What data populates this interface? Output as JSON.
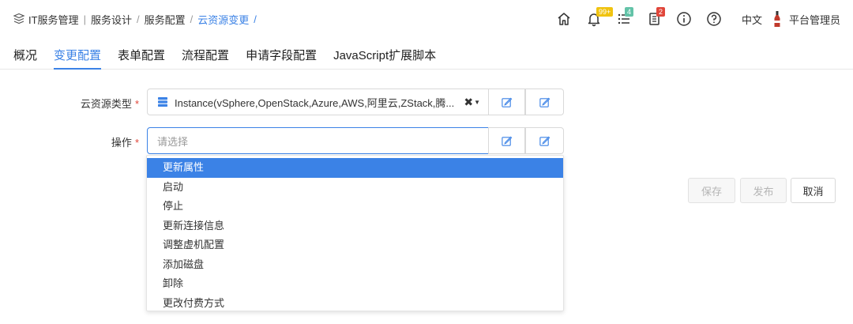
{
  "breadcrumb": {
    "items": [
      "IT服务管理",
      "服务设计",
      "服务配置",
      "云资源变更"
    ],
    "trailing": "/"
  },
  "header": {
    "notifications_badge": "99+",
    "tasks_badge": "4",
    "docs_badge": "2",
    "language": "中文",
    "user_name": "平台管理员"
  },
  "tabs": [
    {
      "label": "概况",
      "active": false
    },
    {
      "label": "变更配置",
      "active": true
    },
    {
      "label": "表单配置",
      "active": false
    },
    {
      "label": "流程配置",
      "active": false
    },
    {
      "label": "申请字段配置",
      "active": false
    },
    {
      "label": "JavaScript扩展脚本",
      "active": false
    }
  ],
  "form": {
    "resource_type": {
      "label": "云资源类型",
      "value": "Instance(vSphere,OpenStack,Azure,AWS,阿里云,ZStack,腾..."
    },
    "operation": {
      "label": "操作",
      "placeholder": "请选择"
    },
    "required_mark": "*"
  },
  "dropdown": {
    "options": [
      "更新属性",
      "启动",
      "停止",
      "更新连接信息",
      "调整虚机配置",
      "添加磁盘",
      "卸除",
      "更改付费方式"
    ],
    "highlighted": 0
  },
  "actions": {
    "save": "保存",
    "publish": "发布",
    "cancel": "取消"
  },
  "colors": {
    "accent": "#3b82e6",
    "required": "#e0463a",
    "badge_yellow": "#f0c30f",
    "badge_green": "#63c3a8",
    "badge_red": "#e0463a"
  },
  "icons": {
    "logo": "stack-logo-icon",
    "home": "home-icon",
    "bell": "bell-icon",
    "tasks": "list-icon",
    "docs": "document-icon",
    "info": "info-icon",
    "help": "help-icon",
    "avatar": "bottle-avatar-icon",
    "resource_type": "server-stack-icon",
    "edit": "edit-icon"
  }
}
